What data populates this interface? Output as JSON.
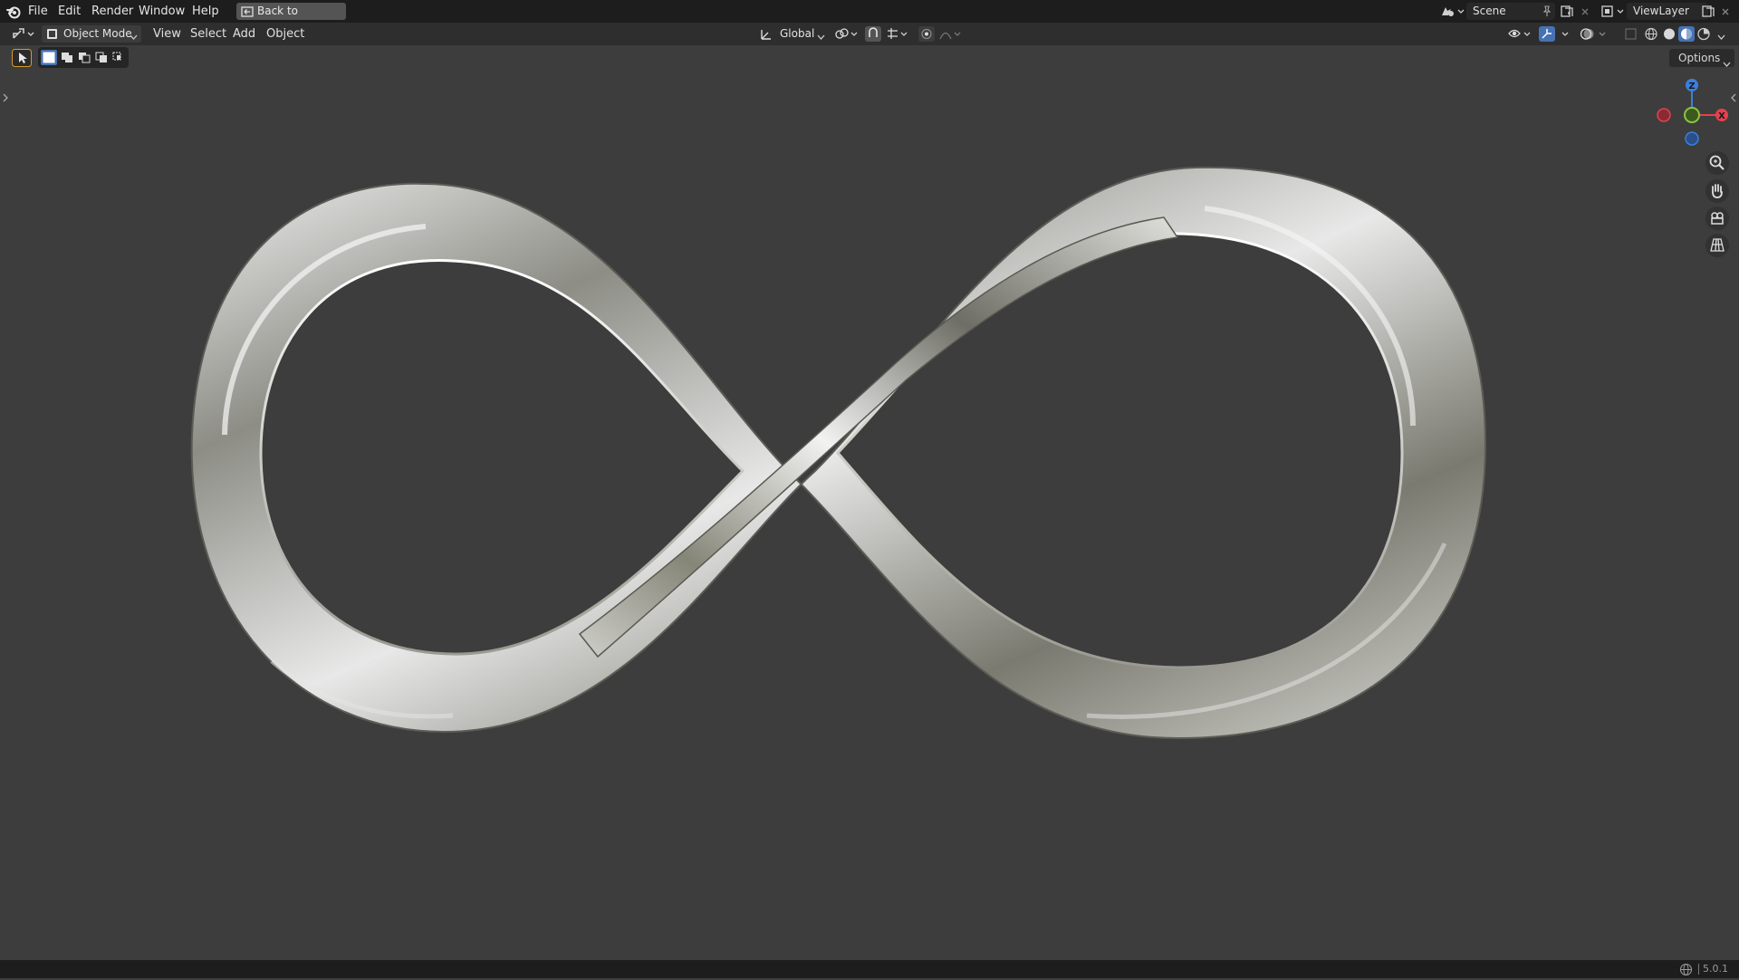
{
  "menu": {
    "items": [
      "File",
      "Edit",
      "Render",
      "Window",
      "Help"
    ],
    "back_button": "Back to Previous"
  },
  "scene": {
    "name": "Scene"
  },
  "view_layer": {
    "name": "ViewLayer"
  },
  "header": {
    "mode": "Object Mode",
    "menus": [
      "View",
      "Select",
      "Add",
      "Object"
    ],
    "orientation": "Global"
  },
  "viewport": {
    "options_label": "Options",
    "gizmo": {
      "z": "Z",
      "x": "X"
    },
    "object": "infinity-symbol-metallic-ribbon"
  },
  "status": {
    "version": "5.0.1"
  },
  "colors": {
    "topbar": "#1d1d1d",
    "header": "#2e2e2e",
    "viewport": "#3d3d3d",
    "axis_x": "#e6404f",
    "axis_y": "#8bc540",
    "axis_z": "#3b7fde",
    "active_tool": "#4772b3"
  }
}
